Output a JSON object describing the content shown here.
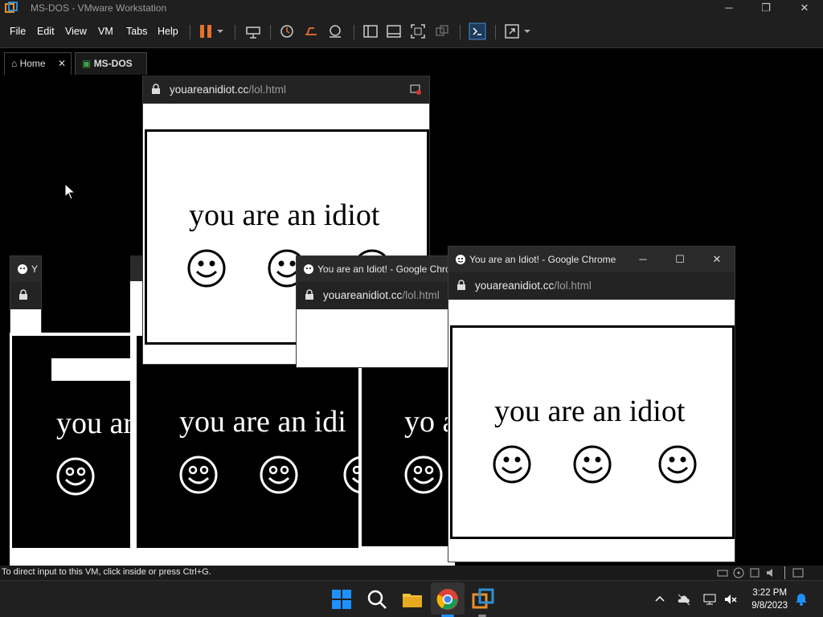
{
  "vmware": {
    "title": "MS-DOS - VMware Workstation",
    "menu": [
      "File",
      "Edit",
      "View",
      "VM",
      "Tabs",
      "Help"
    ],
    "tabs": [
      {
        "label": "Home"
      },
      {
        "label": "MS-DOS"
      }
    ],
    "status_text": "To direct input to this VM, click inside or press Ctrl+G."
  },
  "popup": {
    "window_title": "You are an Idiot! - Google Chrome",
    "url_host": "youareanidiot.cc",
    "url_path": "/lol.html",
    "url_short": "Y",
    "message": "you are an idiot",
    "message_partial_1": "you ar",
    "message_partial_2": "you are an idi",
    "message_partial_3": "yo a"
  },
  "taskbar": {
    "time": "3:22 PM",
    "date": "9/8/2023",
    "apps": [
      "start-icon",
      "search-icon",
      "file-explorer-icon",
      "chrome-icon",
      "vmware-icon"
    ]
  },
  "colors": {
    "accent_pause": "#e8702a",
    "chrome_title": "#2a2a2a",
    "win_blue": "#1e90ff"
  }
}
